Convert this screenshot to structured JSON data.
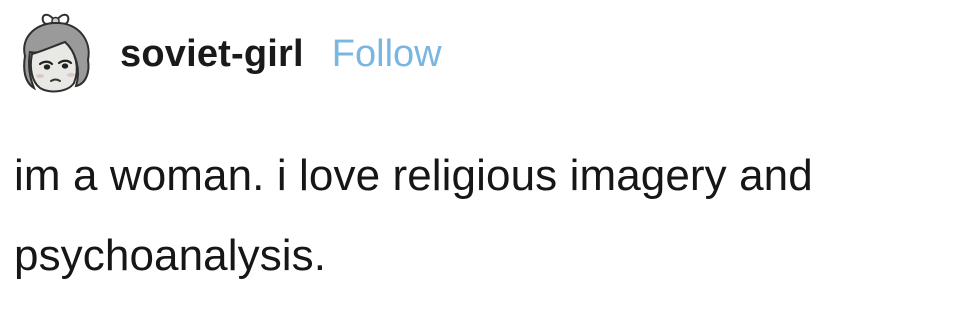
{
  "post": {
    "author": {
      "username": "soviet-girl",
      "avatar_icon": "cartoon-girl-avatar-icon",
      "follow_label": "Follow",
      "follow_color": "#7ab6e2"
    },
    "body": {
      "text": "im a woman. i love religious imagery and psychoanalysis."
    }
  }
}
